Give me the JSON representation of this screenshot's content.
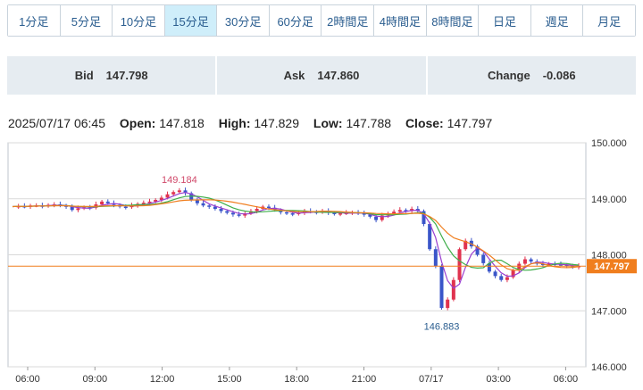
{
  "tabs": [
    {
      "label": "1分足",
      "active": false
    },
    {
      "label": "5分足",
      "active": false
    },
    {
      "label": "10分足",
      "active": false
    },
    {
      "label": "15分足",
      "active": true
    },
    {
      "label": "30分足",
      "active": false
    },
    {
      "label": "60分足",
      "active": false
    },
    {
      "label": "2時間足",
      "active": false
    },
    {
      "label": "4時間足",
      "active": false
    },
    {
      "label": "8時間足",
      "active": false
    },
    {
      "label": "日足",
      "active": false
    },
    {
      "label": "週足",
      "active": false
    },
    {
      "label": "月足",
      "active": false
    }
  ],
  "quote": {
    "bid_label": "Bid",
    "bid": "147.798",
    "ask_label": "Ask",
    "ask": "147.860",
    "change_label": "Change",
    "change": "-0.086"
  },
  "ohlc": {
    "datetime": "2025/07/17 06:45",
    "open_label": "Open:",
    "open": "147.818",
    "high_label": "High:",
    "high": "147.829",
    "low_label": "Low:",
    "low": "147.788",
    "close_label": "Close:",
    "close": "147.797"
  },
  "colors": {
    "up": "#e0334f",
    "down": "#3a55c9",
    "ma_short": "#9b3fd0",
    "ma_mid": "#3fae4a",
    "ma_long": "#f07e1e",
    "last_price": "#f07e1e",
    "active_tab": "#cfeefa",
    "quote_bg": "#e6ecf1"
  },
  "chart_data": {
    "type": "candlestick",
    "ylim": [
      146.0,
      150.0
    ],
    "yticks": [
      "150.000",
      "149.000",
      "148.000",
      "147.000",
      "146.000"
    ],
    "xticks": [
      "06:00",
      "09:00",
      "12:00",
      "15:00",
      "18:00",
      "21:00",
      "07/17",
      "03:00",
      "06:00"
    ],
    "last_price": "147.797",
    "annotation_high": "149.184",
    "annotation_low": "146.883",
    "close_path": [
      148.86,
      148.87,
      148.86,
      148.88,
      148.88,
      148.87,
      148.89,
      148.9,
      148.88,
      148.86,
      148.8,
      148.83,
      148.85,
      148.84,
      148.9,
      148.95,
      148.92,
      148.89,
      148.86,
      148.85,
      148.88,
      148.91,
      148.93,
      148.95,
      148.98,
      149.02,
      149.08,
      149.12,
      149.15,
      149.1,
      148.98,
      148.92,
      148.88,
      148.86,
      148.82,
      148.78,
      148.75,
      148.72,
      148.7,
      148.74,
      148.78,
      148.82,
      148.86,
      148.84,
      148.8,
      148.76,
      148.74,
      148.73,
      148.75,
      148.78,
      148.77,
      148.76,
      148.78,
      148.75,
      148.73,
      148.74,
      148.75,
      148.76,
      148.74,
      148.72,
      148.68,
      148.62,
      148.7,
      148.74,
      148.77,
      148.8,
      148.78,
      148.82,
      148.78,
      148.55,
      148.1,
      147.8,
      147.05,
      147.2,
      147.55,
      148.1,
      148.25,
      148.15,
      148.0,
      147.85,
      147.7,
      147.62,
      147.55,
      147.6,
      147.72,
      147.84,
      147.92,
      147.88,
      147.84,
      147.82,
      147.84,
      147.83,
      147.82,
      147.8,
      147.78,
      147.8
    ]
  }
}
